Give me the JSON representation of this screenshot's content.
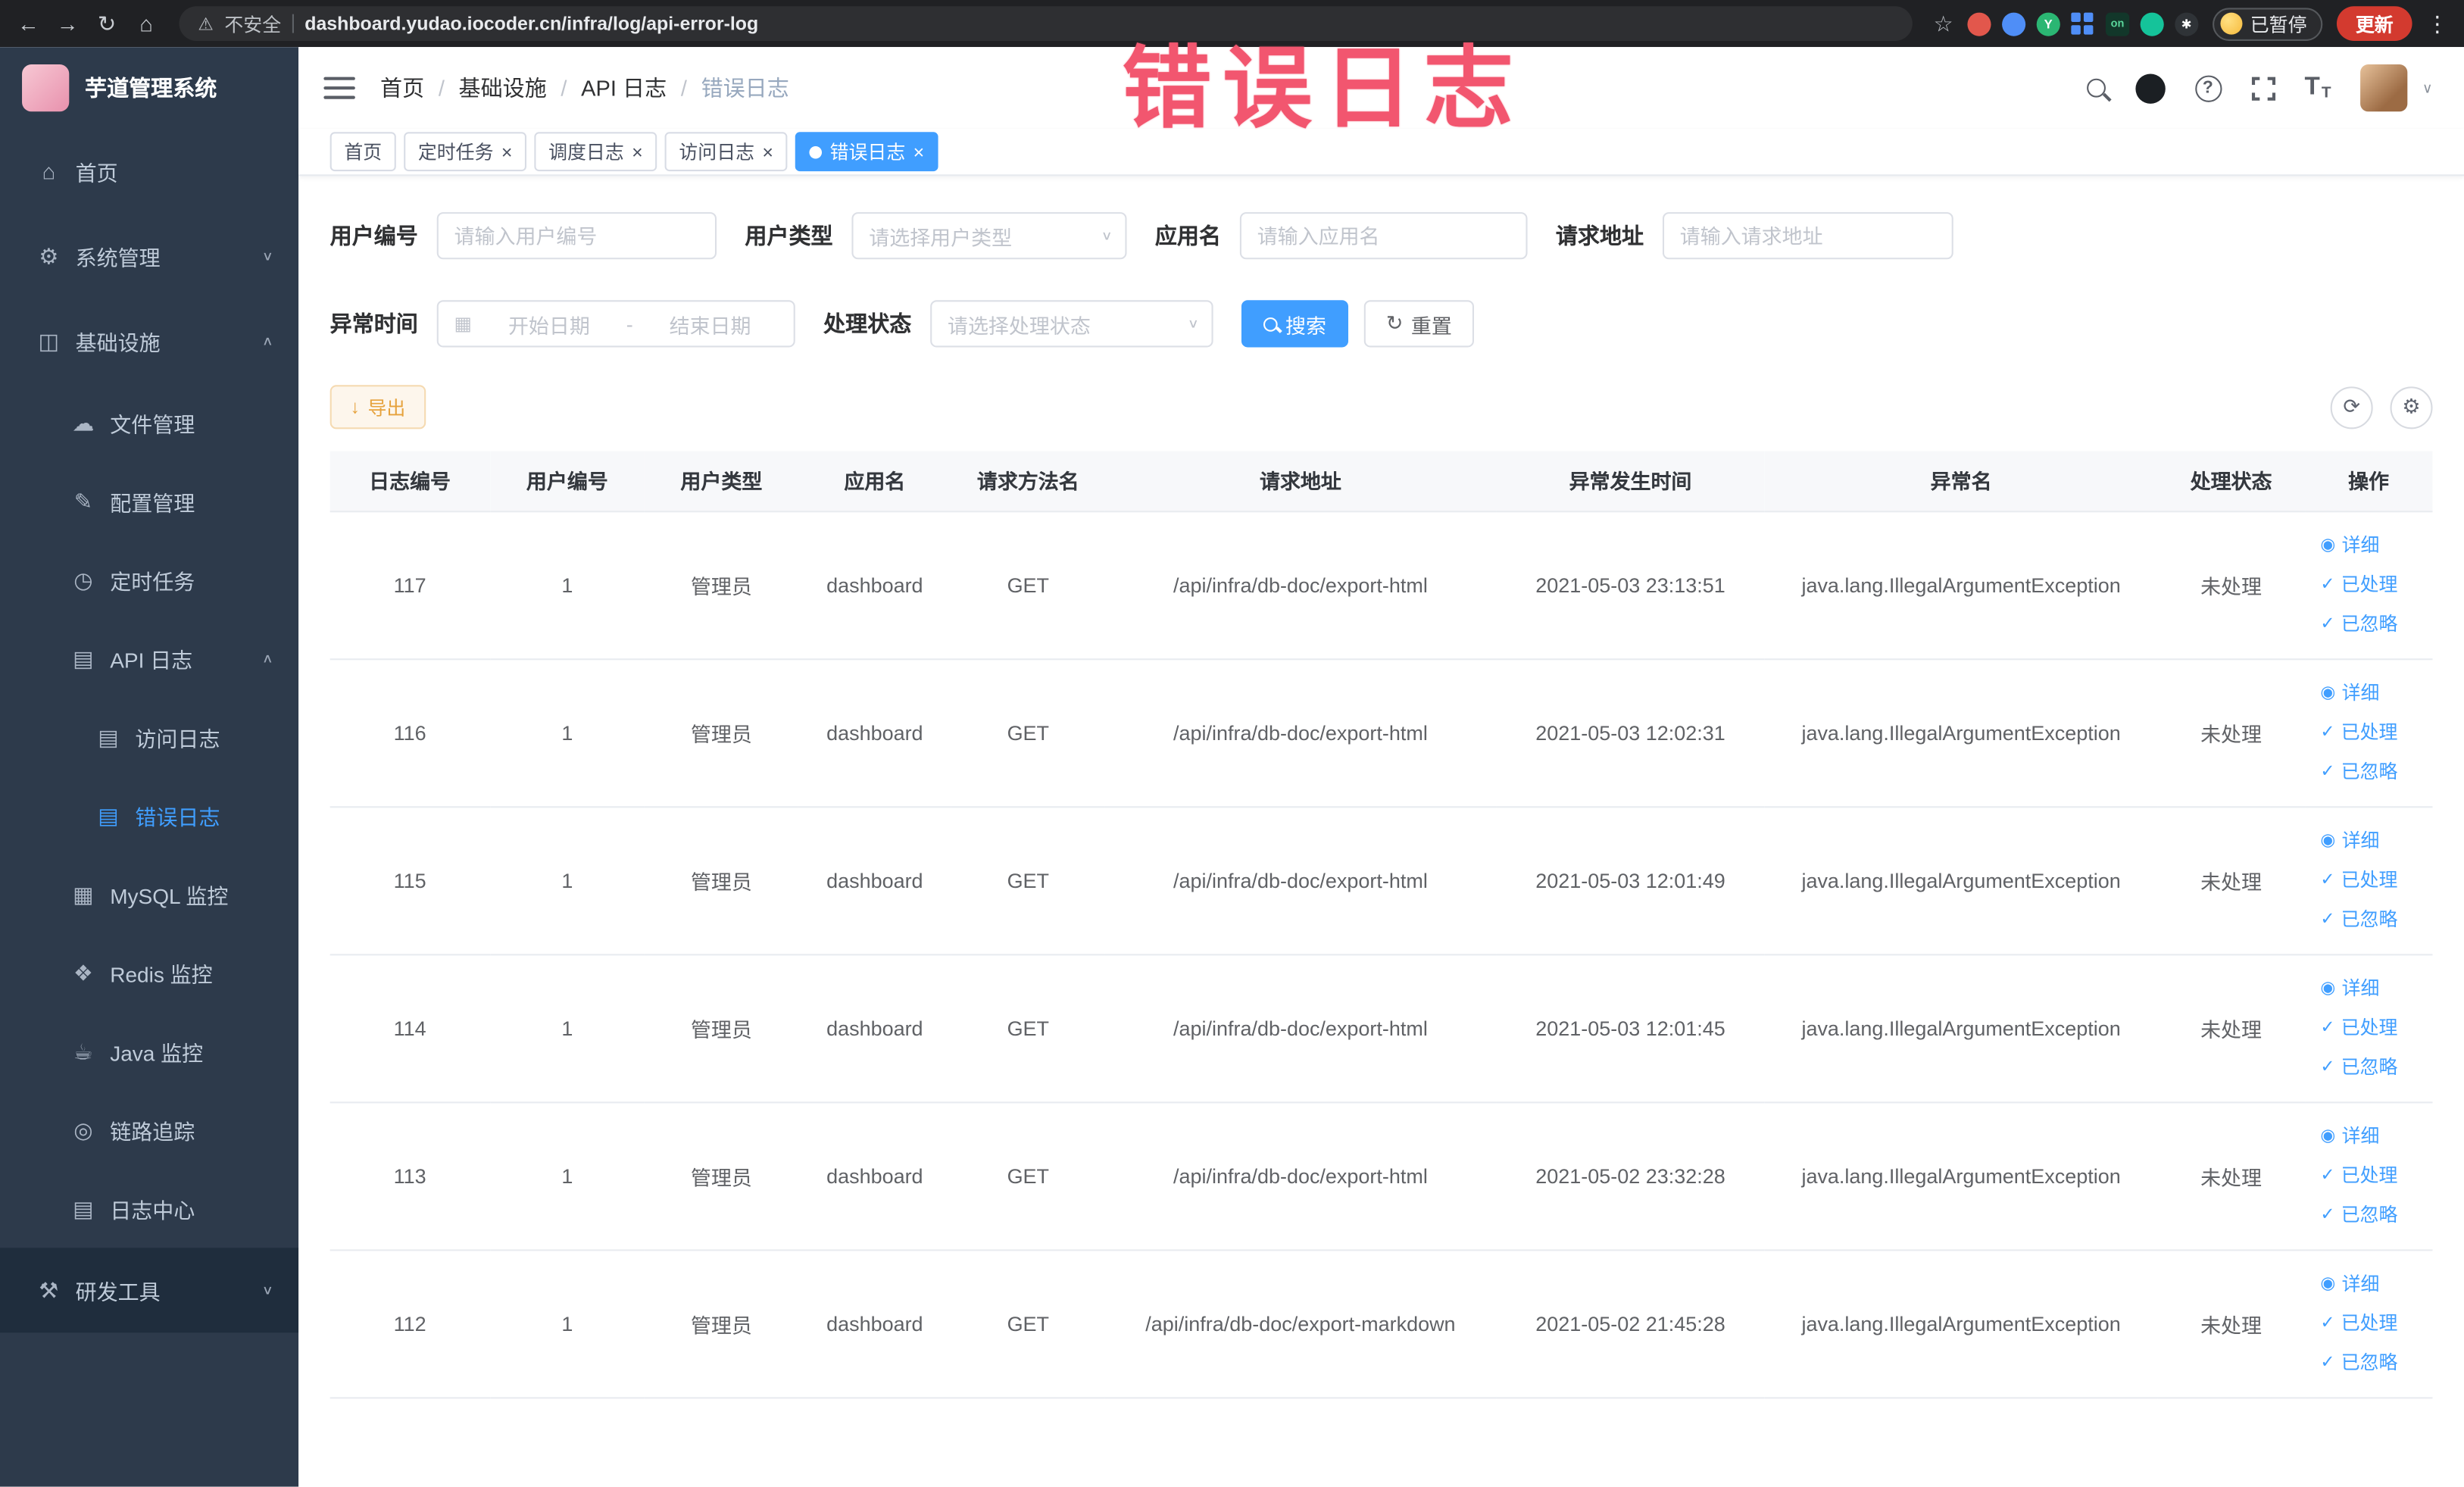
{
  "browser": {
    "security_label": "不安全",
    "url": "dashboard.yudao.iocoder.cn/infra/log/api-error-log",
    "paused_badge": "已暂停",
    "update_button": "更新",
    "icons": {
      "back": "←",
      "forward": "→",
      "reload": "↻",
      "home": "⌂",
      "warning": "⚠",
      "star": "☆",
      "menu": "⋮"
    },
    "extensions": [
      {
        "shape": "circle",
        "color": "#e2574c",
        "label": ""
      },
      {
        "shape": "circle",
        "color": "#4f8ef7",
        "label": ""
      },
      {
        "shape": "circle",
        "color": "#2bb673",
        "label": "Y"
      },
      {
        "shape": "grid",
        "color": "#4f8ef7",
        "label": ""
      },
      {
        "shape": "square",
        "color": "#12372a",
        "label": "on"
      },
      {
        "shape": "circle",
        "color": "#15c39a",
        "label": ""
      },
      {
        "shape": "circle",
        "color": "#2f3337",
        "label": "✱"
      }
    ]
  },
  "overlay": {
    "watermark": "错误日志"
  },
  "sidebar": {
    "logo_title": "芋道管理系统",
    "items": [
      {
        "key": "home",
        "label": "首页",
        "icon": "home-icon",
        "level": 0
      },
      {
        "key": "system",
        "label": "系统管理",
        "icon": "gear-icon",
        "level": 0,
        "chevron": "down"
      },
      {
        "key": "infra",
        "label": "基础设施",
        "icon": "infra-icon",
        "level": 0,
        "chevron": "up"
      },
      {
        "key": "file",
        "label": "文件管理",
        "icon": "file-icon",
        "level": 1
      },
      {
        "key": "config",
        "label": "配置管理",
        "icon": "config-icon",
        "level": 1
      },
      {
        "key": "cron",
        "label": "定时任务",
        "icon": "cron-icon",
        "level": 1
      },
      {
        "key": "api-log",
        "label": "API 日志",
        "icon": "api-log-icon",
        "level": 1,
        "chevron": "up"
      },
      {
        "key": "access-log",
        "label": "访问日志",
        "icon": "doc-icon",
        "level": 2
      },
      {
        "key": "error-log",
        "label": "错误日志",
        "icon": "doc-icon",
        "level": 2,
        "active": true
      },
      {
        "key": "mysql",
        "label": "MySQL 监控",
        "icon": "database-icon",
        "level": 1
      },
      {
        "key": "redis",
        "label": "Redis 监控",
        "icon": "redis-icon",
        "level": 1
      },
      {
        "key": "java",
        "label": "Java 监控",
        "icon": "java-icon",
        "level": 1
      },
      {
        "key": "trace",
        "label": "链路追踪",
        "icon": "trace-icon",
        "level": 1
      },
      {
        "key": "log-center",
        "label": "日志中心",
        "icon": "doc-icon",
        "level": 1
      },
      {
        "key": "devtools",
        "label": "研发工具",
        "icon": "tools-icon",
        "level": 0,
        "chevron": "down",
        "dark": true
      }
    ]
  },
  "header": {
    "breadcrumb": [
      "首页",
      "基础设施",
      "API 日志",
      "错误日志"
    ],
    "help_glyph": "?"
  },
  "tags": [
    {
      "label": "首页",
      "closable": false,
      "active": false
    },
    {
      "label": "定时任务",
      "closable": true,
      "active": false
    },
    {
      "label": "调度日志",
      "closable": true,
      "active": false
    },
    {
      "label": "访问日志",
      "closable": true,
      "active": false
    },
    {
      "label": "错误日志",
      "closable": true,
      "active": true
    }
  ],
  "filters": {
    "user_id": {
      "label": "用户编号",
      "placeholder": "请输入用户编号"
    },
    "user_type": {
      "label": "用户类型",
      "placeholder": "请选择用户类型"
    },
    "app_name": {
      "label": "应用名",
      "placeholder": "请输入应用名"
    },
    "request_url": {
      "label": "请求地址",
      "placeholder": "请输入请求地址"
    },
    "exception_time": {
      "label": "异常时间",
      "start_placeholder": "开始日期",
      "separator": "-",
      "end_placeholder": "结束日期"
    },
    "process_status": {
      "label": "处理状态",
      "placeholder": "请选择处理状态"
    },
    "search_button": "搜索",
    "reset_button": "重置"
  },
  "toolbar": {
    "export_button": "导出"
  },
  "table": {
    "columns": [
      "日志编号",
      "用户编号",
      "用户类型",
      "应用名",
      "请求方法名",
      "请求地址",
      "异常发生时间",
      "异常名",
      "处理状态",
      "操作"
    ],
    "action_labels": {
      "detail": "详细",
      "processed": "已处理",
      "ignored": "已忽略"
    },
    "rows": [
      {
        "id": "117",
        "user_id": "1",
        "user_type": "管理员",
        "app": "dashboard",
        "method": "GET",
        "url": "/api/infra/db-doc/export-html",
        "time": "2021-05-03 23:13:51",
        "exception": "java.lang.IllegalArgumentException",
        "status": "未处理"
      },
      {
        "id": "116",
        "user_id": "1",
        "user_type": "管理员",
        "app": "dashboard",
        "method": "GET",
        "url": "/api/infra/db-doc/export-html",
        "time": "2021-05-03 12:02:31",
        "exception": "java.lang.IllegalArgumentException",
        "status": "未处理"
      },
      {
        "id": "115",
        "user_id": "1",
        "user_type": "管理员",
        "app": "dashboard",
        "method": "GET",
        "url": "/api/infra/db-doc/export-html",
        "time": "2021-05-03 12:01:49",
        "exception": "java.lang.IllegalArgumentException",
        "status": "未处理"
      },
      {
        "id": "114",
        "user_id": "1",
        "user_type": "管理员",
        "app": "dashboard",
        "method": "GET",
        "url": "/api/infra/db-doc/export-html",
        "time": "2021-05-03 12:01:45",
        "exception": "java.lang.IllegalArgumentException",
        "status": "未处理"
      },
      {
        "id": "113",
        "user_id": "1",
        "user_type": "管理员",
        "app": "dashboard",
        "method": "GET",
        "url": "/api/infra/db-doc/export-html",
        "time": "2021-05-02 23:32:28",
        "exception": "java.lang.IllegalArgumentException",
        "status": "未处理"
      },
      {
        "id": "112",
        "user_id": "1",
        "user_type": "管理员",
        "app": "dashboard",
        "method": "GET",
        "url": "/api/infra/db-doc/export-markdown",
        "time": "2021-05-02 21:45:28",
        "exception": "java.lang.IllegalArgumentException",
        "status": "未处理"
      }
    ]
  },
  "colors": {
    "accent": "#409eff",
    "sidebar_bg": "#2d3a4b",
    "sidebar_dark": "#1f2d3d",
    "warning_text": "#e6a23c",
    "warning_bg": "#fdf6ec",
    "warning_border": "#f5dab1",
    "update_button_red": "#d33a2f",
    "watermark_pink": "#f2566f",
    "table_header_bg": "#f7f8fa"
  }
}
